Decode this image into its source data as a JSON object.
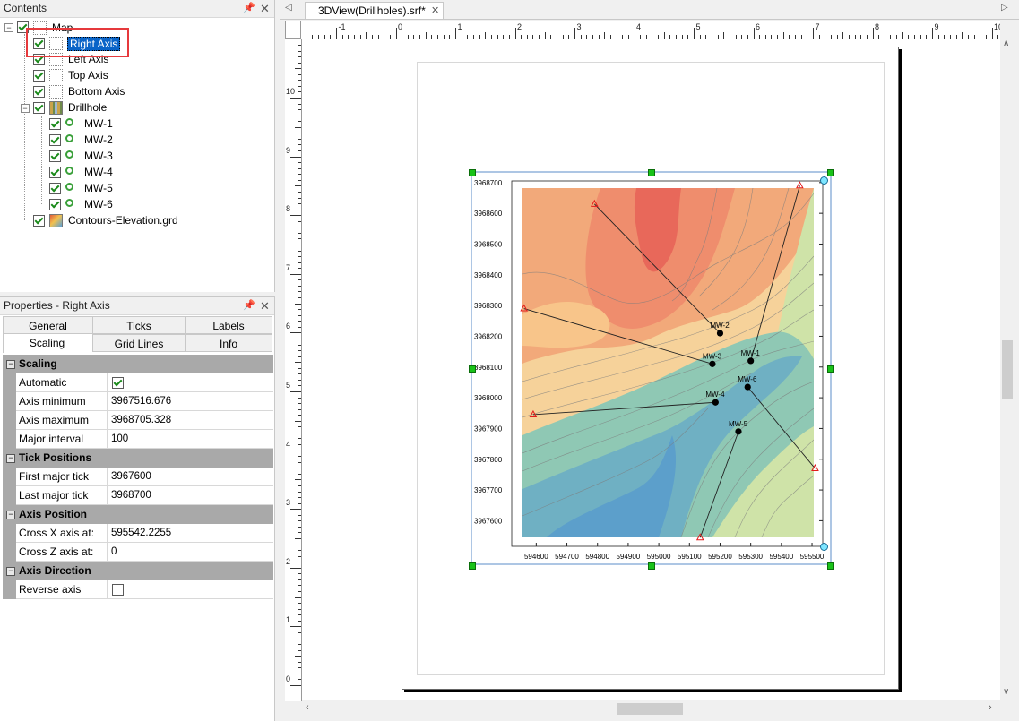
{
  "contents_panel": {
    "title": "Contents",
    "tree": {
      "map": "Map",
      "right_axis": "Right Axis",
      "left_axis": "Left Axis",
      "top_axis": "Top Axis",
      "bottom_axis": "Bottom Axis",
      "drillhole": "Drillhole",
      "wells": [
        "MW-1",
        "MW-2",
        "MW-3",
        "MW-4",
        "MW-5",
        "MW-6"
      ],
      "contours": "Contours-Elevation.grd"
    }
  },
  "properties_panel": {
    "title": "Properties - Right Axis",
    "tabs_row1": [
      "General",
      "Ticks",
      "Labels"
    ],
    "tabs_row2": [
      "Scaling",
      "Grid Lines",
      "Info"
    ],
    "active_tab": "Scaling",
    "sections": {
      "scaling": {
        "header": "Scaling",
        "automatic_label": "Automatic",
        "automatic_checked": true,
        "axis_min_label": "Axis minimum",
        "axis_min_value": "3967516.676",
        "axis_max_label": "Axis maximum",
        "axis_max_value": "3968705.328",
        "major_interval_label": "Major interval",
        "major_interval_value": "100"
      },
      "tick_positions": {
        "header": "Tick Positions",
        "first_label": "First major tick",
        "first_value": "3967600",
        "last_label": "Last major tick",
        "last_value": "3968700"
      },
      "axis_position": {
        "header": "Axis Position",
        "cross_x_label": "Cross X axis at:",
        "cross_x_value": "595542.2255",
        "cross_z_label": "Cross Z axis at:",
        "cross_z_value": "0"
      },
      "axis_direction": {
        "header": "Axis Direction",
        "reverse_label": "Reverse axis",
        "reverse_checked": false
      }
    }
  },
  "document": {
    "tab_title": "3DView(Drillholes).srf*",
    "top_ruler_labels": [
      "-1",
      "0",
      "1",
      "2",
      "3",
      "4",
      "5",
      "6",
      "7",
      "8",
      "9",
      "10"
    ],
    "left_ruler_labels": [
      "10",
      "9",
      "8",
      "7",
      "6",
      "5",
      "4",
      "3",
      "2",
      "1",
      "0"
    ]
  },
  "map": {
    "y_ticks": [
      "3968700",
      "3968600",
      "3968500",
      "3968400",
      "3968300",
      "3968200",
      "3968100",
      "3968000",
      "3967900",
      "3967800",
      "3967700",
      "3967600"
    ],
    "x_ticks": [
      "594600",
      "594700",
      "594800",
      "594900",
      "595000",
      "595100",
      "595200",
      "595300",
      "595400",
      "595500"
    ],
    "wells": [
      {
        "name": "MW-1",
        "x": 595300,
        "y": 3968120,
        "collar_x": 595460,
        "collar_y": 3968690
      },
      {
        "name": "MW-2",
        "x": 595200,
        "y": 3968210,
        "collar_x": 594790,
        "collar_y": 3968630
      },
      {
        "name": "MW-3",
        "x": 595175,
        "y": 3968110,
        "collar_x": 594560,
        "collar_y": 3968290
      },
      {
        "name": "MW-4",
        "x": 595185,
        "y": 3967985,
        "collar_x": 594590,
        "collar_y": 3967945
      },
      {
        "name": "MW-5",
        "x": 595260,
        "y": 3967890,
        "collar_x": 595135,
        "collar_y": 3967545
      },
      {
        "name": "MW-6",
        "x": 595290,
        "y": 3968035,
        "collar_x": 595510,
        "collar_y": 3967770
      }
    ],
    "colors": {
      "high": "#e8685a",
      "mid_high": "#f2a97a",
      "mid": "#f6d29a",
      "mid_low": "#cfe3a8",
      "low": "#8fc8b4",
      "lowest": "#5c9fcb"
    }
  }
}
